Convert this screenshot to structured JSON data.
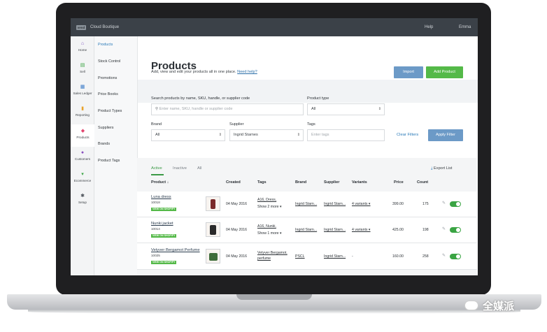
{
  "app": {
    "logo": "vend",
    "store_name": "Cloud Boutique",
    "help": "Help",
    "user": "Emma"
  },
  "nav": [
    {
      "icon": "home-icon",
      "glyph": "⌂",
      "label": "Home"
    },
    {
      "icon": "sell-icon",
      "glyph": "▤",
      "label": "Sell"
    },
    {
      "icon": "sales-ledger-icon",
      "glyph": "▦",
      "label": "Sales Ledger"
    },
    {
      "icon": "reporting-icon",
      "glyph": "▮",
      "label": "Reporting"
    },
    {
      "icon": "products-icon",
      "glyph": "◆",
      "label": "Products"
    },
    {
      "icon": "customers-icon",
      "glyph": "●",
      "label": "Customers"
    },
    {
      "icon": "ecommerce-icon",
      "glyph": "▾",
      "label": "Ecommerce"
    },
    {
      "icon": "setup-icon",
      "glyph": "✱",
      "label": "Setup"
    }
  ],
  "submenu": [
    "Products",
    "Stock Control",
    "Promotions",
    "Price Books",
    "Product Types",
    "Suppliers",
    "Brands",
    "Product Tags"
  ],
  "page": {
    "title": "Products",
    "intro": "Add, view and edit your products all in one place.",
    "help_link": "Need help?",
    "import": "Import",
    "add_product": "Add Product"
  },
  "filters": {
    "search_label": "Search products by name, SKU, handle, or supplier code",
    "search_placeholder": "Enter name, SKU, handle or supplier code",
    "type_label": "Product type",
    "type_value": "All",
    "brand_label": "Brand",
    "brand_value": "All",
    "supplier_label": "Supplier",
    "supplier_value": "Ingrid Starnes",
    "tags_label": "Tags",
    "tags_placeholder": "Enter tags",
    "clear": "Clear Filters",
    "apply": "Apply Filter"
  },
  "list": {
    "tabs": [
      "Active",
      "Inactive",
      "All"
    ],
    "export": "Export List",
    "columns": [
      "Product ↓",
      "Created",
      "Tags",
      "Brand",
      "Supplier",
      "Variants",
      "Price",
      "Count"
    ],
    "badge": "VIEW ON SHOPIFY",
    "rows": [
      {
        "name": "Luna dress",
        "sku": "10018",
        "created": "04 May 2016",
        "tags": "A16, Dress,",
        "tags_more": "Show 2 more ▾",
        "brand": "Ingrid Starn...",
        "supplier": "Ingrid Starn...",
        "variants": "4 variants ▾",
        "price": "399.00",
        "count": "175"
      },
      {
        "name": "Nunki jacket",
        "sku": "10014",
        "created": "04 May 2016",
        "tags": "A16, Nunki,",
        "tags_more": "Show 1 more ▾",
        "brand": "Ingrid Starn...",
        "supplier": "Ingrid Starn...",
        "variants": "4 variants ▾",
        "price": "425.00",
        "count": "198"
      },
      {
        "name": "Vetyver Bergamot Perfume",
        "sku": "10025",
        "created": "04 May 2016",
        "tags": "Vetyver Bergamot,",
        "tags_more": "perfume",
        "brand": "PSCL",
        "supplier": "Ingrid Starn...",
        "variants": "-",
        "price": "160.00",
        "count": "258"
      }
    ]
  },
  "watermark": "全媒派"
}
